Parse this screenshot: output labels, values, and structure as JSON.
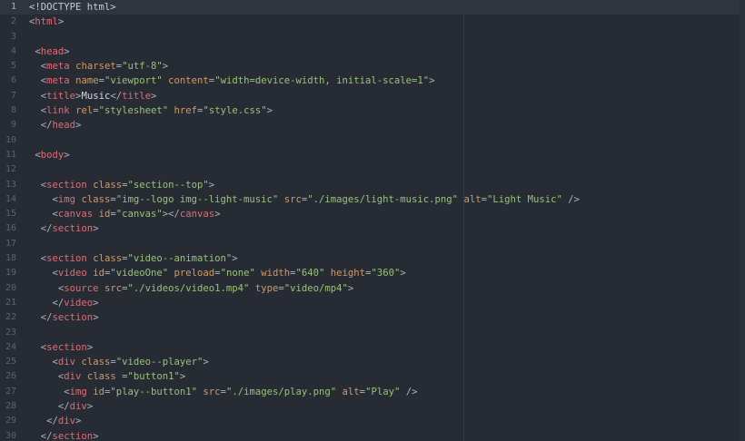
{
  "editor": {
    "first_line_number": 1,
    "active_line": 1,
    "lines": [
      [
        [
          "doc",
          "<!DOCTYPE html>"
        ]
      ],
      [
        [
          "punct",
          "<"
        ],
        [
          "tag",
          "html"
        ],
        [
          "punct",
          ">"
        ]
      ],
      [],
      [
        [
          "text",
          " "
        ],
        [
          "punct",
          "<"
        ],
        [
          "tag",
          "head"
        ],
        [
          "punct",
          ">"
        ]
      ],
      [
        [
          "text",
          "  "
        ],
        [
          "punct",
          "<"
        ],
        [
          "tag",
          "meta"
        ],
        [
          "text",
          " "
        ],
        [
          "attr",
          "charset"
        ],
        [
          "punct",
          "="
        ],
        [
          "str",
          "\"utf-8\""
        ],
        [
          "punct",
          ">"
        ]
      ],
      [
        [
          "text",
          "  "
        ],
        [
          "punct",
          "<"
        ],
        [
          "tag",
          "meta"
        ],
        [
          "text",
          " "
        ],
        [
          "attr",
          "name"
        ],
        [
          "punct",
          "="
        ],
        [
          "str",
          "\"viewport\""
        ],
        [
          "text",
          " "
        ],
        [
          "attr",
          "content"
        ],
        [
          "punct",
          "="
        ],
        [
          "str",
          "\"width=device-width, initial-scale=1\""
        ],
        [
          "punct",
          ">"
        ]
      ],
      [
        [
          "text",
          "  "
        ],
        [
          "punct",
          "<"
        ],
        [
          "tag",
          "title"
        ],
        [
          "punct",
          ">"
        ],
        [
          "text",
          "Music"
        ],
        [
          "punct",
          "</"
        ],
        [
          "tag",
          "title"
        ],
        [
          "punct",
          ">"
        ]
      ],
      [
        [
          "text",
          "  "
        ],
        [
          "punct",
          "<"
        ],
        [
          "tag",
          "link"
        ],
        [
          "text",
          " "
        ],
        [
          "attr",
          "rel"
        ],
        [
          "punct",
          "="
        ],
        [
          "str",
          "\"stylesheet\""
        ],
        [
          "text",
          " "
        ],
        [
          "attr",
          "href"
        ],
        [
          "punct",
          "="
        ],
        [
          "str",
          "\"style.css\""
        ],
        [
          "punct",
          ">"
        ]
      ],
      [
        [
          "text",
          "  "
        ],
        [
          "punct",
          "</"
        ],
        [
          "tag",
          "head"
        ],
        [
          "punct",
          ">"
        ]
      ],
      [],
      [
        [
          "text",
          " "
        ],
        [
          "punct",
          "<"
        ],
        [
          "tag",
          "body"
        ],
        [
          "punct",
          ">"
        ]
      ],
      [],
      [
        [
          "text",
          "  "
        ],
        [
          "punct",
          "<"
        ],
        [
          "tag",
          "section"
        ],
        [
          "text",
          " "
        ],
        [
          "attr",
          "class"
        ],
        [
          "punct",
          "="
        ],
        [
          "str",
          "\"section--top\""
        ],
        [
          "punct",
          ">"
        ]
      ],
      [
        [
          "text",
          "    "
        ],
        [
          "punct",
          "<"
        ],
        [
          "tag",
          "img"
        ],
        [
          "text",
          " "
        ],
        [
          "attr",
          "class"
        ],
        [
          "punct",
          "="
        ],
        [
          "str",
          "\"img--logo img--light-music\""
        ],
        [
          "text",
          " "
        ],
        [
          "attr",
          "src"
        ],
        [
          "punct",
          "="
        ],
        [
          "str",
          "\"./images/light-music.png\""
        ],
        [
          "text",
          " "
        ],
        [
          "attr",
          "alt"
        ],
        [
          "punct",
          "="
        ],
        [
          "str",
          "\"Light Music\""
        ],
        [
          "text",
          " "
        ],
        [
          "punct",
          "/>"
        ]
      ],
      [
        [
          "text",
          "    "
        ],
        [
          "punct",
          "<"
        ],
        [
          "tag",
          "canvas"
        ],
        [
          "text",
          " "
        ],
        [
          "attr",
          "id"
        ],
        [
          "punct",
          "="
        ],
        [
          "str",
          "\"canvas\""
        ],
        [
          "punct",
          "></"
        ],
        [
          "tag",
          "canvas"
        ],
        [
          "punct",
          ">"
        ]
      ],
      [
        [
          "text",
          "  "
        ],
        [
          "punct",
          "</"
        ],
        [
          "tag",
          "section"
        ],
        [
          "punct",
          ">"
        ]
      ],
      [],
      [
        [
          "text",
          "  "
        ],
        [
          "punct",
          "<"
        ],
        [
          "tag",
          "section"
        ],
        [
          "text",
          " "
        ],
        [
          "attr",
          "class"
        ],
        [
          "punct",
          "="
        ],
        [
          "str",
          "\"video--animation\""
        ],
        [
          "punct",
          ">"
        ]
      ],
      [
        [
          "text",
          "    "
        ],
        [
          "punct",
          "<"
        ],
        [
          "tag",
          "video"
        ],
        [
          "text",
          " "
        ],
        [
          "attr",
          "id"
        ],
        [
          "punct",
          "="
        ],
        [
          "str",
          "\"videoOne\""
        ],
        [
          "text",
          " "
        ],
        [
          "attr",
          "preload"
        ],
        [
          "punct",
          "="
        ],
        [
          "str",
          "\"none\""
        ],
        [
          "text",
          " "
        ],
        [
          "attr",
          "width"
        ],
        [
          "punct",
          "="
        ],
        [
          "str",
          "\"640\""
        ],
        [
          "text",
          " "
        ],
        [
          "attr",
          "height"
        ],
        [
          "punct",
          "="
        ],
        [
          "str",
          "\"360\""
        ],
        [
          "punct",
          ">"
        ]
      ],
      [
        [
          "text",
          "     "
        ],
        [
          "punct",
          "<"
        ],
        [
          "tag",
          "source"
        ],
        [
          "text",
          " "
        ],
        [
          "attr",
          "src"
        ],
        [
          "punct",
          "="
        ],
        [
          "str",
          "\"./videos/video1.mp4\""
        ],
        [
          "text",
          " "
        ],
        [
          "attr",
          "type"
        ],
        [
          "punct",
          "="
        ],
        [
          "str",
          "\"video/mp4\""
        ],
        [
          "punct",
          ">"
        ]
      ],
      [
        [
          "text",
          "    "
        ],
        [
          "punct",
          "</"
        ],
        [
          "tag",
          "video"
        ],
        [
          "punct",
          ">"
        ]
      ],
      [
        [
          "text",
          "  "
        ],
        [
          "punct",
          "</"
        ],
        [
          "tag",
          "section"
        ],
        [
          "punct",
          ">"
        ]
      ],
      [],
      [
        [
          "text",
          "  "
        ],
        [
          "punct",
          "<"
        ],
        [
          "tag",
          "section"
        ],
        [
          "punct",
          ">"
        ]
      ],
      [
        [
          "text",
          "    "
        ],
        [
          "punct",
          "<"
        ],
        [
          "tag",
          "div"
        ],
        [
          "text",
          " "
        ],
        [
          "attr",
          "class"
        ],
        [
          "punct",
          "="
        ],
        [
          "str",
          "\"video--player\""
        ],
        [
          "punct",
          ">"
        ]
      ],
      [
        [
          "text",
          "     "
        ],
        [
          "punct",
          "<"
        ],
        [
          "tag",
          "div"
        ],
        [
          "text",
          " "
        ],
        [
          "attr",
          "class"
        ],
        [
          "text",
          " "
        ],
        [
          "punct",
          "="
        ],
        [
          "str",
          "\"button1\""
        ],
        [
          "punct",
          ">"
        ]
      ],
      [
        [
          "text",
          "      "
        ],
        [
          "punct",
          "<"
        ],
        [
          "tag",
          "img"
        ],
        [
          "text",
          " "
        ],
        [
          "attr",
          "id"
        ],
        [
          "punct",
          "="
        ],
        [
          "str",
          "\"play--button1\""
        ],
        [
          "text",
          " "
        ],
        [
          "attr",
          "src"
        ],
        [
          "punct",
          "="
        ],
        [
          "str",
          "\"./images/play.png\""
        ],
        [
          "text",
          " "
        ],
        [
          "attr",
          "alt"
        ],
        [
          "punct",
          "="
        ],
        [
          "str",
          "\"Play\""
        ],
        [
          "text",
          " "
        ],
        [
          "punct",
          "/>"
        ]
      ],
      [
        [
          "text",
          "     "
        ],
        [
          "punct",
          "</"
        ],
        [
          "tag",
          "div"
        ],
        [
          "punct",
          ">"
        ]
      ],
      [
        [
          "text",
          "   "
        ],
        [
          "punct",
          "</"
        ],
        [
          "tag",
          "div"
        ],
        [
          "punct",
          ">"
        ]
      ],
      [
        [
          "text",
          "  "
        ],
        [
          "punct",
          "</"
        ],
        [
          "tag",
          "section"
        ],
        [
          "punct",
          ">"
        ]
      ]
    ]
  }
}
